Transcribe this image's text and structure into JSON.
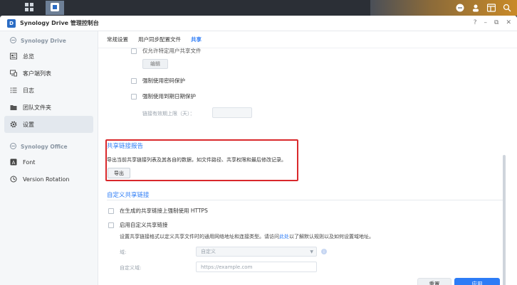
{
  "taskbar": {
    "icons": [
      "grid-icon",
      "drive-app-icon",
      "chat-icon",
      "user-icon",
      "widget-icon",
      "search-icon"
    ]
  },
  "window": {
    "title": "Synology Drive 管理控制台",
    "controls": [
      "?",
      "–",
      "⧉",
      "✕"
    ]
  },
  "sidebar": {
    "section1": "Synology Drive",
    "items1": [
      {
        "label": "总览",
        "icon": "overview-icon"
      },
      {
        "label": "客户端列表",
        "icon": "client-list-icon"
      },
      {
        "label": "日志",
        "icon": "log-icon"
      },
      {
        "label": "团队文件夹",
        "icon": "team-folder-icon"
      },
      {
        "label": "设置",
        "icon": "gear-icon",
        "active": true
      }
    ],
    "section2": "Synology Office",
    "items2": [
      {
        "label": "Font",
        "icon": "font-icon"
      },
      {
        "label": "Version Rotation",
        "icon": "history-icon"
      }
    ]
  },
  "tabs": [
    "常规设置",
    "用户同步配置文件",
    "共享"
  ],
  "share": {
    "partial_option": "仅允许特定用户共享文件",
    "edit_button": "编辑",
    "force_password": "强制使用密码保护",
    "force_expiry": "强制使用到期日期保护",
    "expiry_label": "链接有效期上限（天）：",
    "report_title": "共享链接报告",
    "report_desc": "导出当前共享链接列表及其各自的数据，如文件路径、共享权限和最后修改记录。",
    "export_button": "导出",
    "custom_title": "自定义共享链接",
    "force_https": "在生成的共享链接上强制使用 HTTPS",
    "enable_custom": "启用自定义共享链接",
    "custom_desc_pre": "设置共享链接格式以定义共享文件时的通用网络地址和连接类型。请访问",
    "custom_desc_link": "此处",
    "custom_desc_post": "以了解默认规则以及如何设置域地址。",
    "domain_label": "域:",
    "domain_value": "自定义",
    "custom_domain_label": "自定义域:",
    "custom_domain_placeholder": "https://example.com"
  },
  "footer": {
    "reset": "重置",
    "apply": "应用"
  }
}
